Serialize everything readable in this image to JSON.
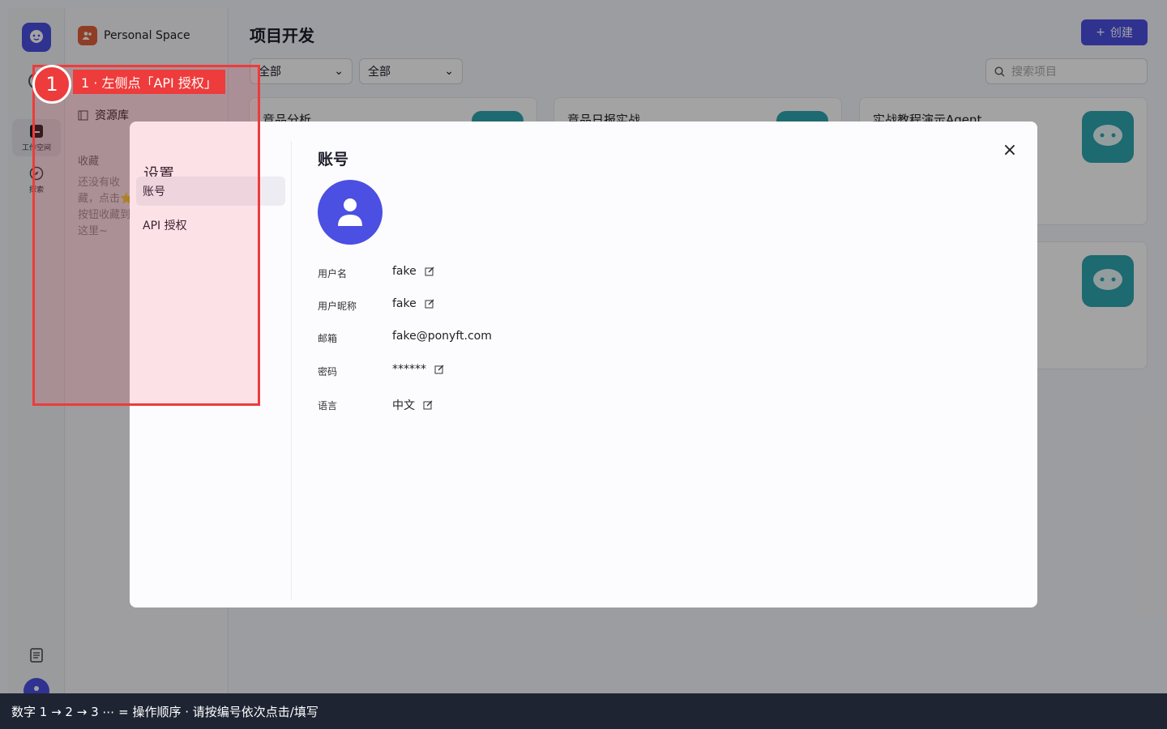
{
  "rail": {
    "workspace_label": "工作空间",
    "explore_label": "探索"
  },
  "side": {
    "space_name": "Personal Space",
    "library_label": "资源库",
    "favorites_label": "收藏",
    "favorites_empty": "还没有收藏，点击⭐按钮收藏到这里~"
  },
  "main": {
    "title": "项目开发",
    "create_label": "创建",
    "filter1": "全部",
    "filter2": "全部",
    "search_placeholder": "搜索项目",
    "cards": [
      {
        "title": "竞品分析"
      },
      {
        "title": "竞品日报实战"
      },
      {
        "title": "实战教程演示Agent"
      }
    ]
  },
  "modal": {
    "title": "设置",
    "nav": [
      "账号",
      "API 授权"
    ],
    "content_title": "账号",
    "fields": [
      {
        "label": "用户名",
        "value": "fake"
      },
      {
        "label": "用户昵称",
        "value": "fake"
      },
      {
        "label": "邮箱",
        "value": "fake@ponyft.com"
      },
      {
        "label": "密码",
        "value": "******"
      },
      {
        "label": "语言",
        "value": "中文"
      }
    ],
    "close_symbol": "×"
  },
  "annotation": {
    "step_number": "1",
    "step_text": "1 ·   左侧点「API 授权」",
    "highlight_color": "#ee3b3b"
  },
  "footer": {
    "hint": "数字 1 → 2 → 3 ⋯ = 操作顺序 ·   请按编号依次点击/填写"
  },
  "colors": {
    "accent": "#4b4fe2",
    "card_icon": "#2ea7b0"
  }
}
